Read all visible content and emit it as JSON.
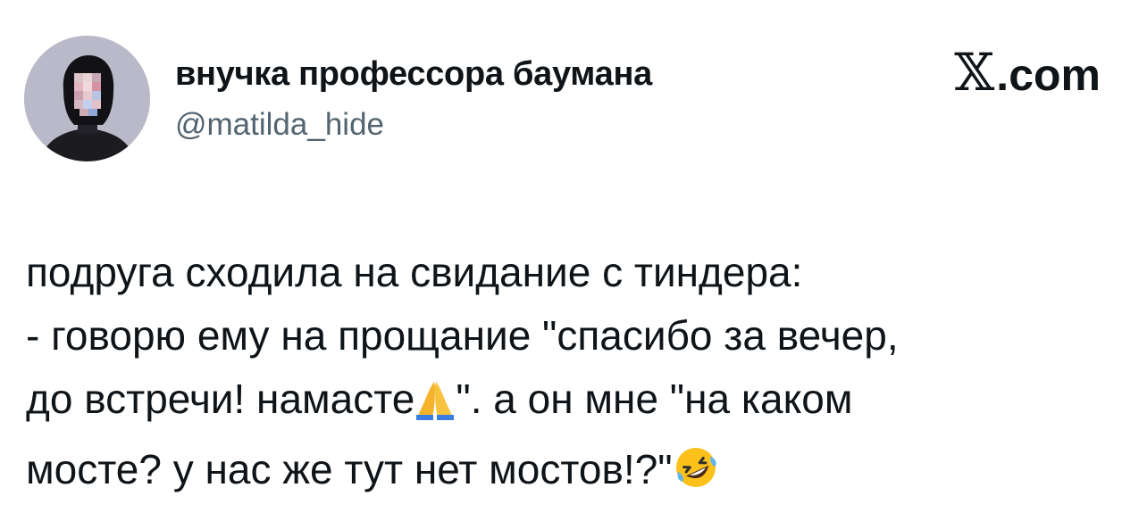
{
  "author": {
    "display_name": "внучка профессора баумана",
    "handle": "@matilda_hide",
    "avatar_icon": "profile-photo-avatar"
  },
  "brand": {
    "logo_icon": "x-logo-icon",
    "domain": ".com"
  },
  "tweet": {
    "line1": "подруга сходила на свидание с тиндера:",
    "line2": "- говорю ему на прощание \"спасибо за вечер,",
    "line3_before": "до встречи! намасте",
    "line3_emoji": "folded-hands-emoji",
    "line3_after": "\". а он мне \"на каком",
    "line4_before": "мосте? у нас же тут нет мостов!?\"",
    "line4_emoji": "rolling-on-the-floor-laughing-emoji"
  }
}
